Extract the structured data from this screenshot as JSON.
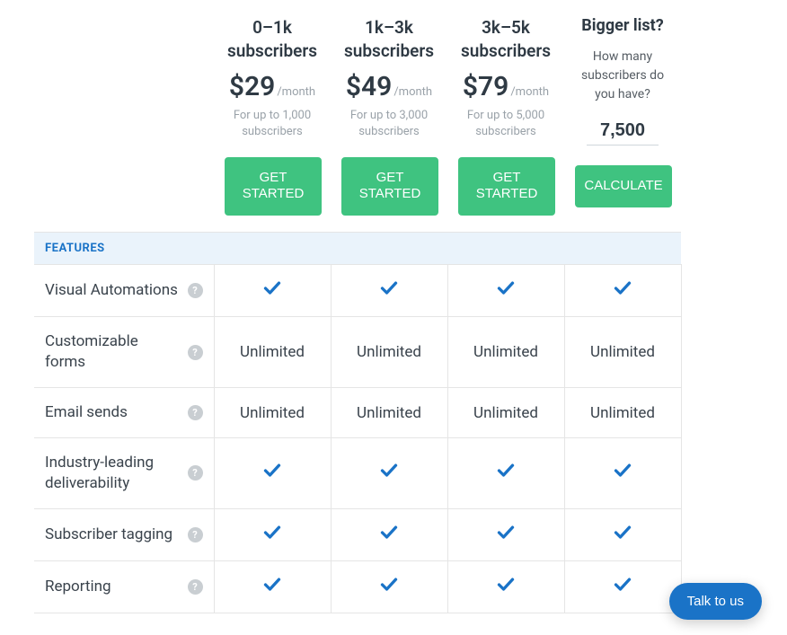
{
  "plans": [
    {
      "title": "0–1k subscribers",
      "price": "$29",
      "period": "/month",
      "sub": "For up to 1,000 subscribers",
      "cta": "GET STARTED"
    },
    {
      "title": "1k–3k subscribers",
      "price": "$49",
      "period": "/month",
      "sub": "For up to 3,000 subscribers",
      "cta": "GET STARTED"
    },
    {
      "title": "3k–5k subscribers",
      "price": "$79",
      "period": "/month",
      "sub": "For up to 5,000 subscribers",
      "cta": "GET STARTED"
    }
  ],
  "bigger": {
    "title": "Bigger list?",
    "question": "How many subscribers do you have?",
    "input_value": "7,500",
    "cta": "CALCULATE"
  },
  "features_header": "FEATURES",
  "help_glyph": "?",
  "features": [
    {
      "label": "Visual Automations",
      "values": [
        "check",
        "check",
        "check",
        "check"
      ]
    },
    {
      "label": "Customizable forms",
      "values": [
        "Unlimited",
        "Unlimited",
        "Unlimited",
        "Unlimited"
      ]
    },
    {
      "label": "Email sends",
      "values": [
        "Unlimited",
        "Unlimited",
        "Unlimited",
        "Unlimited"
      ]
    },
    {
      "label": "Industry-leading deliverability",
      "values": [
        "check",
        "check",
        "check",
        "check"
      ]
    },
    {
      "label": "Subscriber tagging",
      "values": [
        "check",
        "check",
        "check",
        "check"
      ]
    },
    {
      "label": "Reporting",
      "values": [
        "check",
        "check",
        "check",
        "check"
      ]
    }
  ],
  "chat": {
    "label": "Talk to us"
  }
}
